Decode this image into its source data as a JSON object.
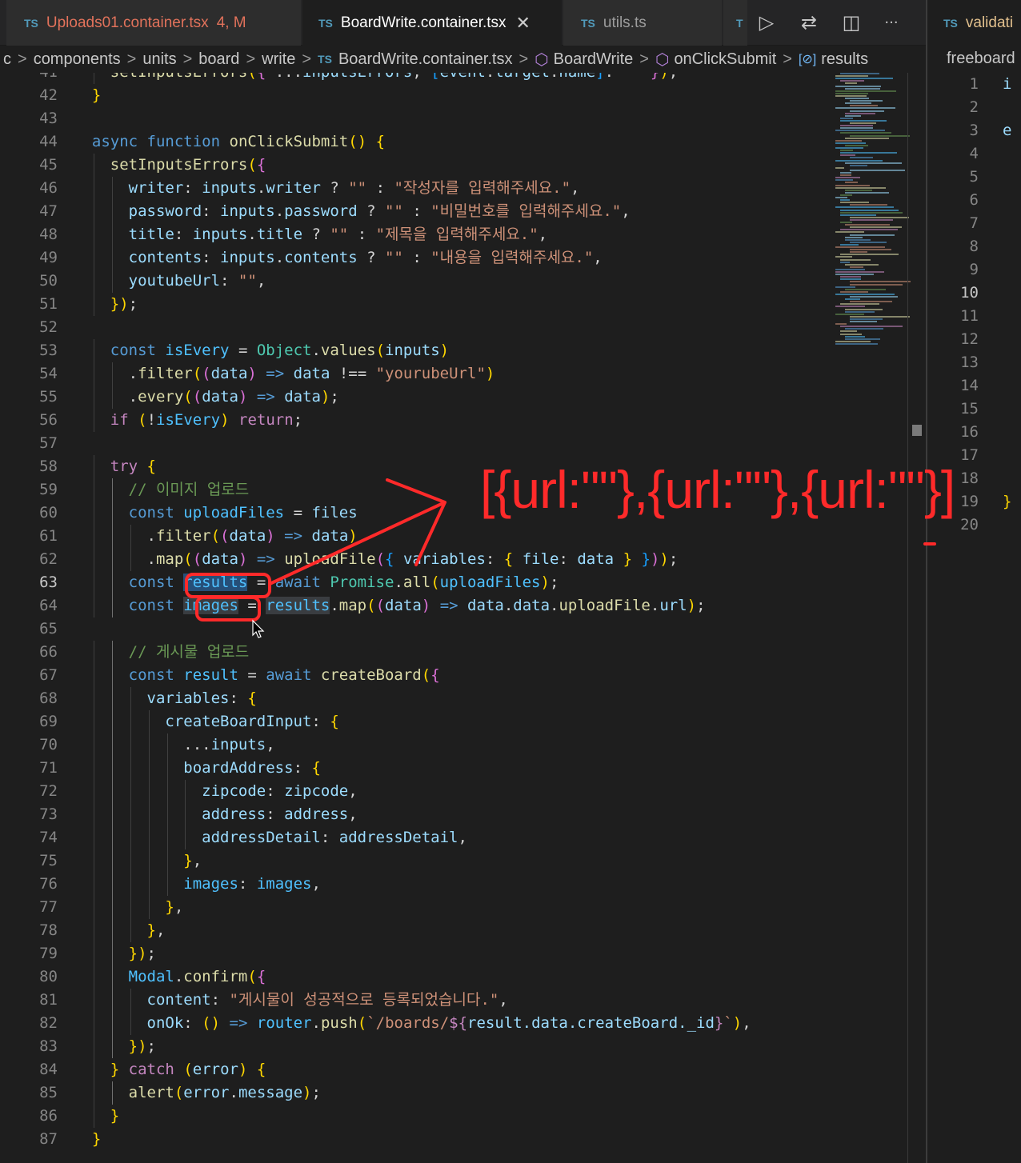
{
  "tabs": [
    {
      "lang": "TS",
      "name": "Uploads01.container.tsx",
      "status": "4, M"
    },
    {
      "lang": "TS",
      "name": "BoardWrite.container.tsx",
      "close": "✕"
    },
    {
      "lang": "TS",
      "name": "utils.ts"
    },
    {
      "lang": "T"
    }
  ],
  "toolbar": {
    "run": "▷",
    "compare": "⇄",
    "split": "◫",
    "more": "···"
  },
  "breadcrumb": {
    "items": [
      "c",
      "components",
      "units",
      "board",
      "write",
      "BoardWrite.container.tsx",
      "BoardWrite",
      "onClickSubmit",
      "results"
    ],
    "sep": ">",
    "lang": "TS",
    "cube": "⬡",
    "var": "[⊘]"
  },
  "editor": {
    "current_line": "63",
    "lines": [
      {
        "n": "41",
        "text": "    setInputsErrors({ ...inputsErrors, [event.target.name]: \"\" });"
      },
      {
        "n": "42",
        "text": "  }"
      },
      {
        "n": "43",
        "text": ""
      },
      {
        "n": "44",
        "text": "  async function onClickSubmit() {"
      },
      {
        "n": "45",
        "text": "    setInputsErrors({"
      },
      {
        "n": "46",
        "text": "      writer: inputs.writer ? \"\" : \"작성자를 입력해주세요.\","
      },
      {
        "n": "47",
        "text": "      password: inputs.password ? \"\" : \"비밀번호를 입력해주세요.\","
      },
      {
        "n": "48",
        "text": "      title: inputs.title ? \"\" : \"제목을 입력해주세요.\","
      },
      {
        "n": "49",
        "text": "      contents: inputs.contents ? \"\" : \"내용을 입력해주세요.\","
      },
      {
        "n": "50",
        "text": "      youtubeUrl: \"\","
      },
      {
        "n": "51",
        "text": "    });"
      },
      {
        "n": "52",
        "text": ""
      },
      {
        "n": "53",
        "text": "    const isEvery = Object.values(inputs)"
      },
      {
        "n": "54",
        "text": "      .filter((data) => data !== \"yourubeUrl\")"
      },
      {
        "n": "55",
        "text": "      .every((data) => data);"
      },
      {
        "n": "56",
        "text": "    if (!isEvery) return;"
      },
      {
        "n": "57",
        "text": ""
      },
      {
        "n": "58",
        "text": "    try {"
      },
      {
        "n": "59",
        "text": "      // 이미지 업로드"
      },
      {
        "n": "60",
        "text": "      const uploadFiles = files"
      },
      {
        "n": "61",
        "text": "        .filter((data) => data)"
      },
      {
        "n": "62",
        "text": "        .map((data) => uploadFile({ variables: { file: data } }));"
      },
      {
        "n": "63",
        "text": "      const results = await Promise.all(uploadFiles);"
      },
      {
        "n": "64",
        "text": "      const images = results.map((data) => data.data.uploadFile.url);"
      },
      {
        "n": "65",
        "text": ""
      },
      {
        "n": "66",
        "text": "      // 게시물 업로드"
      },
      {
        "n": "67",
        "text": "      const result = await createBoard({"
      },
      {
        "n": "68",
        "text": "        variables: {"
      },
      {
        "n": "69",
        "text": "          createBoardInput: {"
      },
      {
        "n": "70",
        "text": "            ...inputs,"
      },
      {
        "n": "71",
        "text": "            boardAddress: {"
      },
      {
        "n": "72",
        "text": "              zipcode: zipcode,"
      },
      {
        "n": "73",
        "text": "              address: address,"
      },
      {
        "n": "74",
        "text": "              addressDetail: addressDetail,"
      },
      {
        "n": "75",
        "text": "            },"
      },
      {
        "n": "76",
        "text": "            images: images,"
      },
      {
        "n": "77",
        "text": "          },"
      },
      {
        "n": "78",
        "text": "        },"
      },
      {
        "n": "79",
        "text": "      });"
      },
      {
        "n": "80",
        "text": "      Modal.confirm({"
      },
      {
        "n": "81",
        "text": "        content: \"게시물이 성공적으로 등록되었습니다.\","
      },
      {
        "n": "82",
        "text": "        onOk: () => router.push(`/boards/${result.data.createBoard._id}`),"
      },
      {
        "n": "83",
        "text": "      });"
      },
      {
        "n": "84",
        "text": "    } catch (error) {"
      },
      {
        "n": "85",
        "text": "      alert(error.message);"
      },
      {
        "n": "86",
        "text": "    }"
      },
      {
        "n": "87",
        "text": "  }"
      }
    ]
  },
  "right_pane": {
    "tab_lang": "TS",
    "tab_name": "validati",
    "breadcrumb": "freeboard",
    "current_line": "10",
    "lines": [
      {
        "n": "1",
        "text": "i"
      },
      {
        "n": "2",
        "text": ""
      },
      {
        "n": "3",
        "text": "e"
      },
      {
        "n": "4",
        "text": ""
      },
      {
        "n": "5",
        "text": ""
      },
      {
        "n": "6",
        "text": ""
      },
      {
        "n": "7",
        "text": ""
      },
      {
        "n": "8",
        "text": ""
      },
      {
        "n": "9",
        "text": ""
      },
      {
        "n": "10",
        "text": ""
      },
      {
        "n": "11",
        "text": ""
      },
      {
        "n": "12",
        "text": ""
      },
      {
        "n": "13",
        "text": ""
      },
      {
        "n": "14",
        "text": ""
      },
      {
        "n": "15",
        "text": ""
      },
      {
        "n": "16",
        "text": ""
      },
      {
        "n": "17",
        "text": ""
      },
      {
        "n": "18",
        "text": ""
      },
      {
        "n": "19",
        "text": "}"
      },
      {
        "n": "20",
        "text": ""
      }
    ]
  },
  "annotation": {
    "text": "[{url:\"\"},{url:\"\"},{url:\"\"}]",
    "color": "#ff2a2a"
  },
  "colors": {
    "accent": "#007acc",
    "modified": "#e2725b",
    "selection": "#264f78"
  }
}
